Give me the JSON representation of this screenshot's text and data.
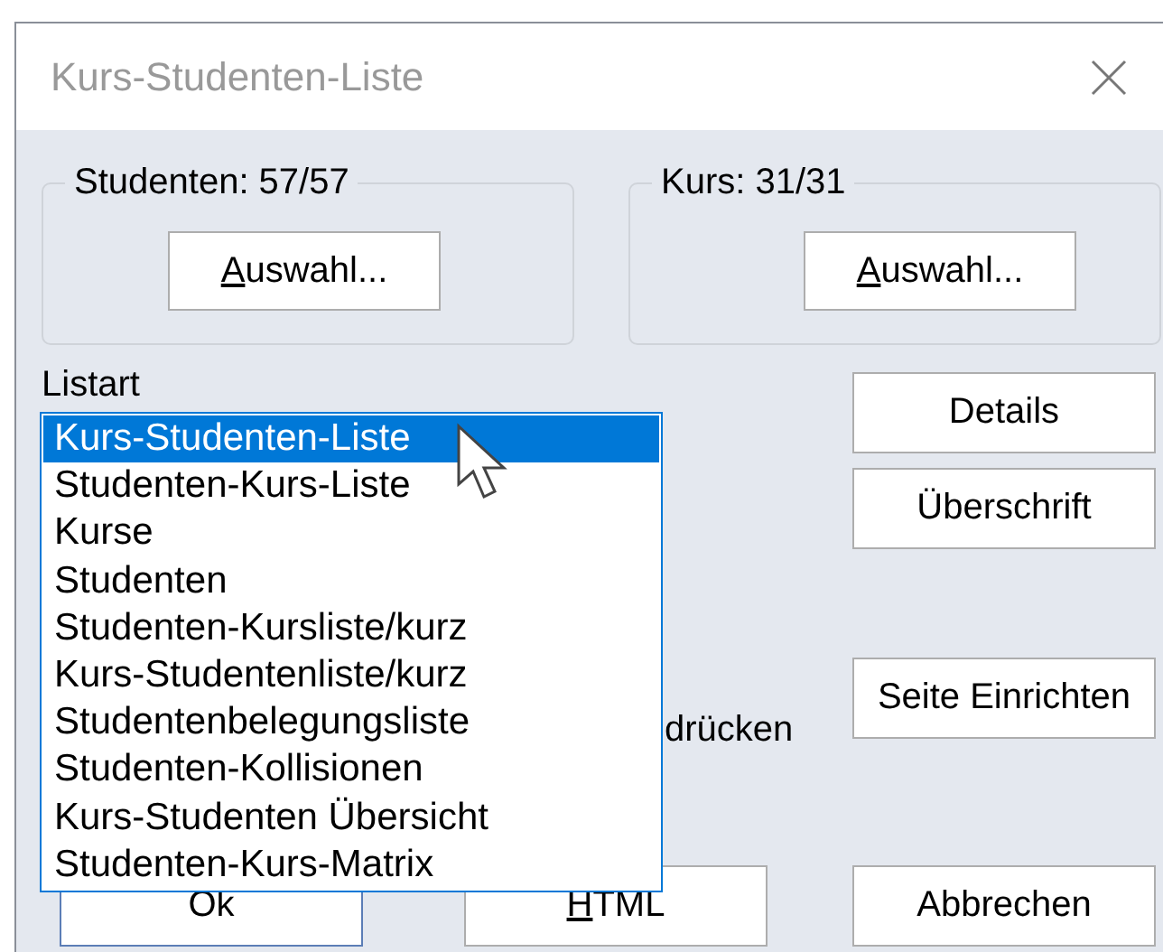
{
  "window": {
    "title": "Kurs-Studenten-Liste"
  },
  "groups": [
    {
      "label": "Studenten: 57/57",
      "button": {
        "label": "Auswahl...",
        "mnemonic_first": true
      }
    },
    {
      "label": "Kurs: 31/31",
      "button": {
        "label": "Auswahl...",
        "mnemonic_first": true
      }
    }
  ],
  "listart": {
    "label": "Listart"
  },
  "list_type_dropdown": {
    "items": [
      {
        "label": "Kurs-Studenten-Liste",
        "selected": true
      },
      {
        "label": "Studenten-Kurs-Liste",
        "selected": false
      },
      {
        "label": "Kurse",
        "selected": false
      },
      {
        "label": "Studenten",
        "selected": false
      },
      {
        "label": "Studenten-Kursliste/kurz",
        "selected": false
      },
      {
        "label": "Kurs-Studentenliste/kurz",
        "selected": false
      },
      {
        "label": "Studentenbelegungsliste",
        "selected": false
      },
      {
        "label": "Studenten-Kollisionen",
        "selected": false
      },
      {
        "label": "Kurs-Studenten Übersicht",
        "selected": false
      },
      {
        "label": "Studenten-Kurs-Matrix",
        "selected": false
      }
    ]
  },
  "option_label": "drücken",
  "side_buttons": [
    {
      "label": "Details"
    },
    {
      "label": "Überschrift"
    },
    {
      "label": "Seite Einrichten"
    }
  ],
  "bottom_buttons": [
    {
      "label": "Ok",
      "default": true,
      "mnemonic_first": false
    },
    {
      "label": "HTML",
      "default": false,
      "mnemonic_first": true
    },
    {
      "label": "Abbrechen",
      "default": false,
      "mnemonic_first": false
    }
  ]
}
